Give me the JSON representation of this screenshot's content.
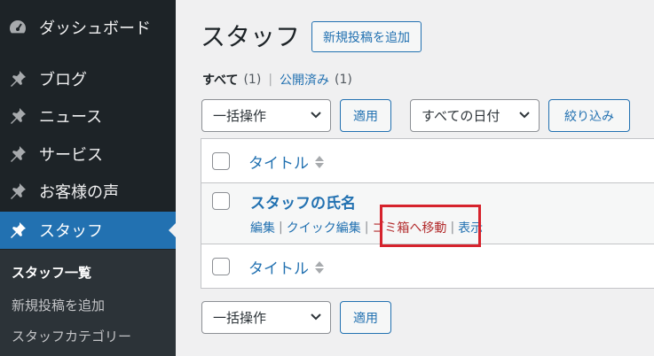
{
  "sidebar": {
    "items": [
      {
        "label": "ダッシュボード",
        "icon": "dashboard-icon"
      },
      {
        "label": "ブログ",
        "icon": "pin-icon"
      },
      {
        "label": "ニュース",
        "icon": "pin-icon"
      },
      {
        "label": "サービス",
        "icon": "pin-icon"
      },
      {
        "label": "お客様の声",
        "icon": "pin-icon"
      },
      {
        "label": "スタッフ",
        "icon": "pin-icon"
      }
    ],
    "submenu": [
      "スタッフ一覧",
      "新規投稿を追加",
      "スタッフカテゴリー"
    ]
  },
  "header": {
    "title": "スタッフ",
    "add_new": "新規投稿を追加"
  },
  "filters": {
    "all_label": "すべて",
    "all_count": "(1)",
    "separator": "|",
    "published_label": "公開済み",
    "published_count": "(1)"
  },
  "toolbar_top": {
    "bulk_action": "一括操作",
    "apply": "適用",
    "date_filter": "すべての日付",
    "filter_button": "絞り込み"
  },
  "table": {
    "column_title": "タイトル",
    "post": {
      "title": "スタッフの氏名",
      "actions": [
        "編集",
        "クイック編集",
        "ゴミ箱へ移動",
        "表示"
      ]
    }
  },
  "toolbar_bottom": {
    "bulk_action": "一括操作",
    "apply": "適用"
  },
  "colors": {
    "accent": "#2271b1",
    "sidebar_bg": "#1d2327",
    "trash": "#b32d2e",
    "highlight": "#d6232d"
  }
}
